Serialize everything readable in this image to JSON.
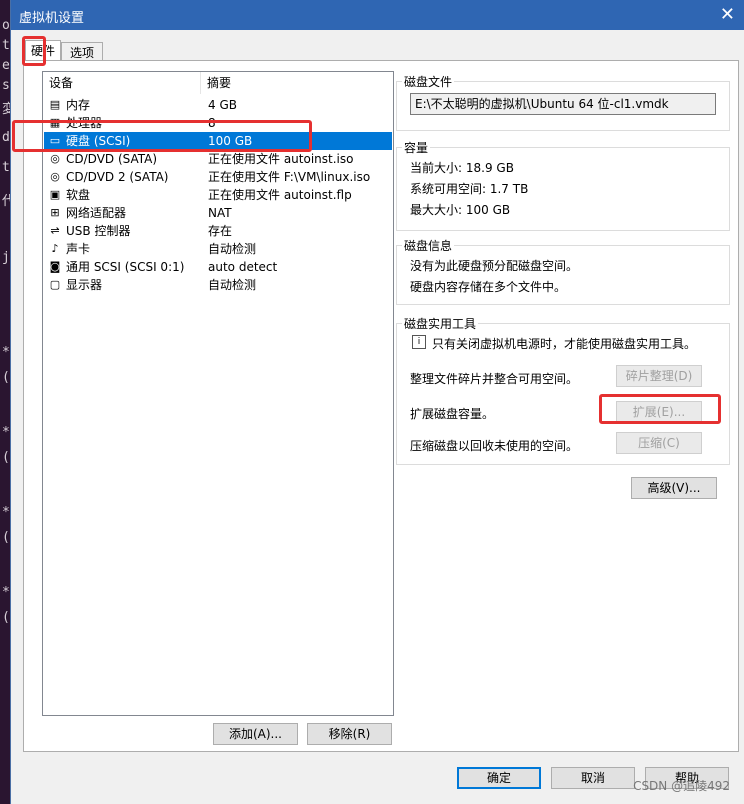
{
  "background_terminal": {
    "chars": [
      "o",
      "t",
      "e",
      "s",
      "変",
      "d",
      "t",
      "代",
      "j",
      "*",
      "(",
      "*",
      "(",
      "*",
      "(",
      "*",
      "("
    ]
  },
  "dialog": {
    "title": "虚拟机设置",
    "tabs": [
      "硬件",
      "选项"
    ],
    "device_list": {
      "headers": [
        "设备",
        "摘要"
      ],
      "rows": [
        {
          "icon": "memory-icon",
          "device": "内存",
          "summary": "4 GB",
          "selected": false
        },
        {
          "icon": "processor-icon",
          "device": "处理器",
          "summary": "8",
          "selected": false
        },
        {
          "icon": "hard-disk-icon",
          "device": "硬盘 (SCSI)",
          "summary": "100 GB",
          "selected": true
        },
        {
          "icon": "cd-dvd-icon",
          "device": "CD/DVD (SATA)",
          "summary": "正在使用文件 autoinst.iso",
          "selected": false
        },
        {
          "icon": "cd-dvd-icon",
          "device": "CD/DVD 2 (SATA)",
          "summary": "正在使用文件 F:\\VM\\linux.iso",
          "selected": false
        },
        {
          "icon": "floppy-icon",
          "device": "软盘",
          "summary": "正在使用文件 autoinst.flp",
          "selected": false
        },
        {
          "icon": "network-adapter-icon",
          "device": "网络适配器",
          "summary": "NAT",
          "selected": false
        },
        {
          "icon": "usb-controller-icon",
          "device": "USB 控制器",
          "summary": "存在",
          "selected": false
        },
        {
          "icon": "sound-card-icon",
          "device": "声卡",
          "summary": "自动检测",
          "selected": false
        },
        {
          "icon": "scsi-icon",
          "device": "通用 SCSI (SCSI 0:1)",
          "summary": "auto detect",
          "selected": false
        },
        {
          "icon": "display-icon",
          "device": "显示器",
          "summary": "自动检测",
          "selected": false
        }
      ]
    },
    "add_button": "添加(A)...",
    "remove_button": "移除(R)",
    "disk_file": {
      "title": "磁盘文件",
      "path": "E:\\不太聪明的虚拟机\\Ubuntu 64 位-cl1.vmdk"
    },
    "capacity": {
      "title": "容量",
      "current": "当前大小: 18.9 GB",
      "available": "系统可用空间: 1.7 TB",
      "max": "最大大小: 100 GB"
    },
    "disk_info": {
      "title": "磁盘信息",
      "line1": "没有为此硬盘预分配磁盘空间。",
      "line2": "硬盘内容存储在多个文件中。"
    },
    "utilities": {
      "title": "磁盘实用工具",
      "note": "只有关闭虚拟机电源时，才能使用磁盘实用工具。",
      "defrag_label": "整理文件碎片并整合可用空间。",
      "defrag_button": "碎片整理(D)",
      "expand_label": "扩展磁盘容量。",
      "expand_button": "扩展(E)...",
      "compact_label": "压缩磁盘以回收未使用的空间。",
      "compact_button": "压缩(C)"
    },
    "advanced_button": "高级(V)...",
    "ok_button": "确定",
    "cancel_button": "取消",
    "help_button": "帮助"
  },
  "watermark": "CSDN @追陵492",
  "colors": {
    "titlebar": "#2f66b3",
    "selection": "#0078d7",
    "annotation_red": "#e53030"
  }
}
